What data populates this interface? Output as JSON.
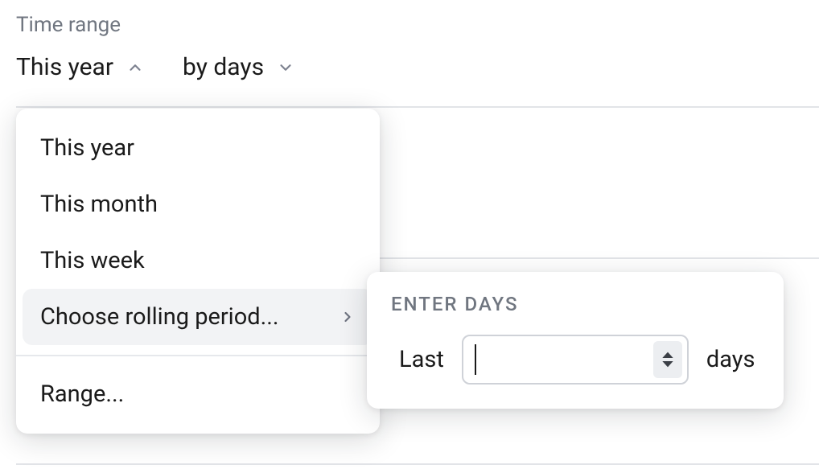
{
  "header": {
    "section_label": "Time range"
  },
  "selectors": {
    "range": {
      "label": "This year"
    },
    "granularity": {
      "label": "by days"
    }
  },
  "dropdown": {
    "options": [
      {
        "label": "This year"
      },
      {
        "label": "This month"
      },
      {
        "label": "This week"
      },
      {
        "label": "Choose rolling period..."
      },
      {
        "label": "Range..."
      }
    ]
  },
  "rolling_popover": {
    "title": "Enter days",
    "prefix": "Last",
    "suffix": "days",
    "input_value": "",
    "input_placeholder": ""
  }
}
